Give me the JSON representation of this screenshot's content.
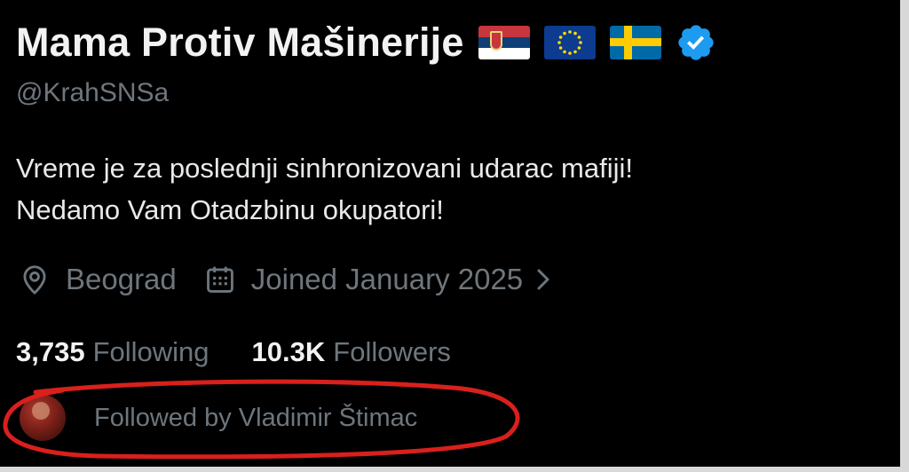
{
  "profile": {
    "display_name": "Mama Protiv Mašinerije",
    "handle": "@KrahSNSa",
    "flags": [
      "serbia-flag-icon",
      "eu-flag-icon",
      "sweden-flag-icon"
    ],
    "verified_color": "#1d9bf0",
    "bio_line1": "Vreme je za poslednji sinhronizovani udarac mafiji!",
    "bio_line2": "Nedamo Vam Otadzbinu okupatori!",
    "location": "Beograd",
    "joined": "Joined January 2025"
  },
  "stats": {
    "following_count": "3,735",
    "following_label": "Following",
    "followers_count": "10.3K",
    "followers_label": "Followers"
  },
  "followed_by": {
    "text": "Followed by Vladimir Štimac"
  },
  "annotation": {
    "color": "#d9201c"
  }
}
